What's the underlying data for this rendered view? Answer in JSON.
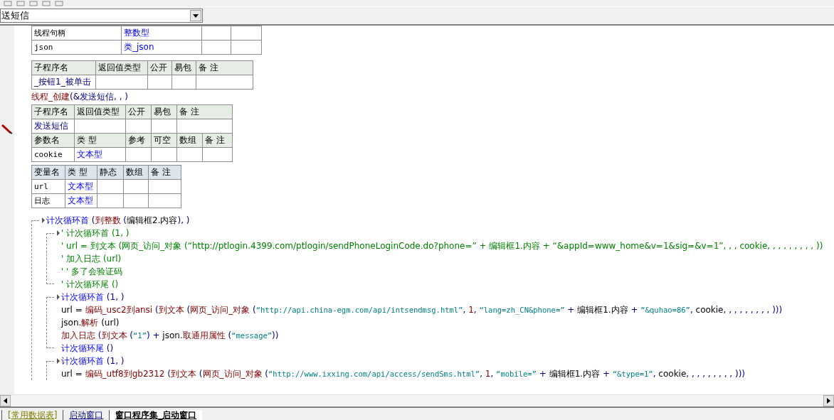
{
  "selector": {
    "value": "送短信"
  },
  "assembly_vars": {
    "rows": [
      {
        "name": "线程句柄",
        "type": "整数型"
      },
      {
        "name": "json",
        "type": "类_json"
      }
    ]
  },
  "event_sub": {
    "columns": [
      "子程序名",
      "返回值类型",
      "公开",
      "易包",
      "备 注"
    ],
    "name": "_按钮1_被单击"
  },
  "thread_call": [
    {
      "t": "线程_创建",
      "kind": "fn"
    },
    {
      "t": " (&发送短信, , )",
      "kind": "op"
    }
  ],
  "sub": {
    "columns": [
      "子程序名",
      "返回值类型",
      "公开",
      "易包",
      "备 注"
    ],
    "name": "发送短信",
    "param_columns": [
      "参数名",
      "类 型",
      "参考",
      "可空",
      "数组",
      "备 注"
    ],
    "params": [
      {
        "name": "cookie",
        "type": "文本型"
      }
    ]
  },
  "locals": {
    "columns": [
      "变量名",
      "类 型",
      "静态",
      "数组",
      "备 注"
    ],
    "rows": [
      {
        "name": "url",
        "type": "文本型"
      },
      {
        "name": "日志",
        "type": "文本型"
      }
    ]
  },
  "code": [
    {
      "kind": "loop",
      "head": [
        {
          "t": "计次循环首",
          "kind": "kw"
        },
        {
          "t": " (",
          "kind": "op"
        },
        {
          "t": "到整数",
          "kind": "fn"
        },
        {
          "t": " (",
          "kind": "op"
        },
        {
          "t": "编辑框2.内容",
          "kind": "plain"
        },
        {
          "t": "), )",
          "kind": "op"
        }
      ],
      "body": [
        {
          "kind": "loop",
          "head": [
            {
              "t": "' 计次循环首 (1, )",
              "kind": "comment"
            }
          ],
          "body": [
            {
              "kind": "line",
              "segs": [
                {
                  "t": "' url = 到文本 (网页_访问_对象 (“http://ptlogin.4399.com/ptlogin/sendPhoneLoginCode.do?phone=” + 编辑框1.内容 + “&appId=www_home&v=1&sig=&v=1”, , , cookie, , , , , , , , , ))",
                  "kind": "comment"
                }
              ]
            },
            {
              "kind": "line",
              "segs": [
                {
                  "t": "' 加入日志 (url)",
                  "kind": "comment"
                }
              ]
            },
            {
              "kind": "line",
              "segs": [
                {
                  "t": "' ' 多了会验证码",
                  "kind": "comment"
                }
              ]
            }
          ],
          "tail": [
            {
              "t": "' 计次循环尾 ()",
              "kind": "comment"
            }
          ]
        },
        {
          "kind": "loop",
          "head": [
            {
              "t": "计次循环首",
              "kind": "kw"
            },
            {
              "t": " (1, )",
              "kind": "op"
            }
          ],
          "body": [
            {
              "kind": "line",
              "segs": [
                {
                  "t": "url = ",
                  "kind": "plain"
                },
                {
                  "t": "编码_usc2到ansi",
                  "kind": "fn"
                },
                {
                  "t": " (",
                  "kind": "op"
                },
                {
                  "t": "到文本",
                  "kind": "fn"
                },
                {
                  "t": " (",
                  "kind": "op"
                },
                {
                  "t": "网页_访问_对象",
                  "kind": "fn"
                },
                {
                  "t": " (",
                  "kind": "op"
                },
                {
                  "t": "“http://api.china-egm.com/api/intsendmsg.html”",
                  "kind": "str"
                },
                {
                  "t": ", ",
                  "kind": "op"
                },
                {
                  "t": "1",
                  "kind": "num"
                },
                {
                  "t": ", ",
                  "kind": "op"
                },
                {
                  "t": "“lang=zh_CN&phone=”",
                  "kind": "str"
                },
                {
                  "t": " + ",
                  "kind": "op"
                },
                {
                  "t": "编辑框1.内容",
                  "kind": "plain"
                },
                {
                  "t": " + ",
                  "kind": "op"
                },
                {
                  "t": "“&quhao=86”",
                  "kind": "str"
                },
                {
                  "t": ", ",
                  "kind": "op"
                },
                {
                  "t": "cookie",
                  "kind": "plain"
                },
                {
                  "t": ", , , , , , , , , )))",
                  "kind": "op"
                }
              ]
            },
            {
              "kind": "line",
              "segs": [
                {
                  "t": "json.",
                  "kind": "plain"
                },
                {
                  "t": "解析",
                  "kind": "fn"
                },
                {
                  "t": " (url)",
                  "kind": "plain"
                }
              ]
            },
            {
              "kind": "line",
              "segs": [
                {
                  "t": "加入日志",
                  "kind": "fn"
                },
                {
                  "t": " (",
                  "kind": "op"
                },
                {
                  "t": "到文本",
                  "kind": "fn"
                },
                {
                  "t": " (",
                  "kind": "op"
                },
                {
                  "t": "“1”",
                  "kind": "str"
                },
                {
                  "t": ") + ",
                  "kind": "op"
                },
                {
                  "t": "json.",
                  "kind": "plain"
                },
                {
                  "t": "取通用属性",
                  "kind": "fn"
                },
                {
                  "t": " (",
                  "kind": "op"
                },
                {
                  "t": "“message”",
                  "kind": "str"
                },
                {
                  "t": "))",
                  "kind": "op"
                }
              ]
            }
          ],
          "tail": [
            {
              "t": "计次循环尾",
              "kind": "kw"
            },
            {
              "t": " ()",
              "kind": "op"
            }
          ]
        },
        {
          "kind": "loop",
          "head": [
            {
              "t": "计次循环首",
              "kind": "kw"
            },
            {
              "t": " (1, )",
              "kind": "op"
            }
          ],
          "body": [
            {
              "kind": "line",
              "segs": [
                {
                  "t": "url = ",
                  "kind": "plain"
                },
                {
                  "t": "编码_utf8到gb2312",
                  "kind": "fn"
                },
                {
                  "t": " (",
                  "kind": "op"
                },
                {
                  "t": "到文本",
                  "kind": "fn"
                },
                {
                  "t": " (",
                  "kind": "op"
                },
                {
                  "t": "网页_访问_对象",
                  "kind": "fn"
                },
                {
                  "t": " (",
                  "kind": "op"
                },
                {
                  "t": "“http://www.ixxing.com/api/access/sendSms.html”",
                  "kind": "str"
                },
                {
                  "t": ", ",
                  "kind": "op"
                },
                {
                  "t": "1",
                  "kind": "num"
                },
                {
                  "t": ", ",
                  "kind": "op"
                },
                {
                  "t": "“mobile=”",
                  "kind": "str"
                },
                {
                  "t": " + ",
                  "kind": "op"
                },
                {
                  "t": "编辑框1.内容",
                  "kind": "plain"
                },
                {
                  "t": " + ",
                  "kind": "op"
                },
                {
                  "t": "“&type=1”",
                  "kind": "str"
                },
                {
                  "t": ", ",
                  "kind": "op"
                },
                {
                  "t": "cookie",
                  "kind": "plain"
                },
                {
                  "t": ", , , , , , , , , )))",
                  "kind": "op"
                }
              ]
            }
          ]
        }
      ]
    }
  ],
  "tabs": [
    {
      "label": "[常用数据表]",
      "selected": false,
      "color": "#808000"
    },
    {
      "label": "启动窗口",
      "selected": false,
      "color": "#000080"
    },
    {
      "label": "窗口程序集_启动窗口",
      "selected": true,
      "color": "#000000"
    }
  ]
}
